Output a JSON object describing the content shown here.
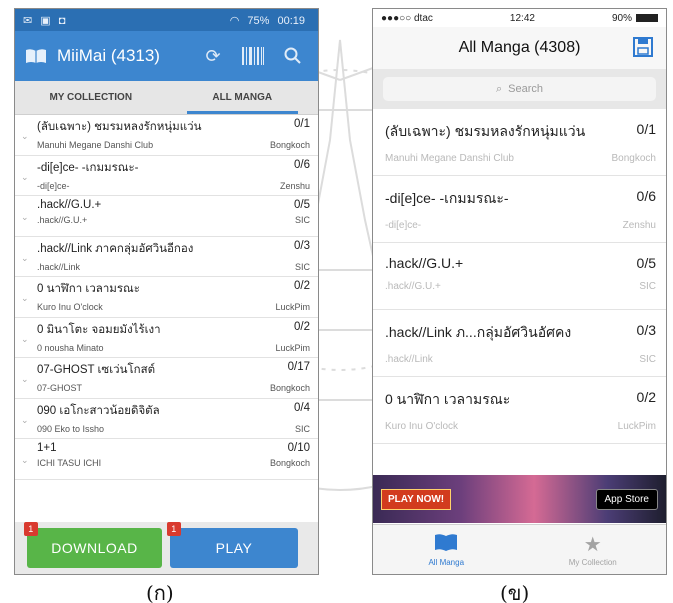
{
  "android": {
    "status": {
      "battery": "75%",
      "time": "00:19"
    },
    "appbar": {
      "title": "MiiMai (4313)",
      "icons": [
        "book-icon",
        "refresh-icon",
        "barcode-icon",
        "search-icon"
      ]
    },
    "tabs": [
      {
        "label": "MY COLLECTION",
        "active": false
      },
      {
        "label": "ALL MANGA",
        "active": true
      }
    ],
    "rows": [
      {
        "title": "(ลับเฉพาะ) ชมรมหลงรักหนุ่มแว่น",
        "count": "0/1",
        "subtitle": "Manuhi Megane Danshi Club",
        "publisher": "Bongkoch"
      },
      {
        "title": "-di[e]ce- -เกมมรณะ-",
        "count": "0/6",
        "subtitle": "-di[e]ce-",
        "publisher": "Zenshu"
      },
      {
        "title": ".hack//G.U.+",
        "count": "0/5",
        "subtitle": ".hack//G.U.+",
        "publisher": "SIC"
      },
      {
        "title": ".hack//Link ภาคกลุ่มอัศวินอีกอง",
        "count": "0/3",
        "subtitle": ".hack//Link",
        "publisher": "SIC"
      },
      {
        "title": "0 นาฬิกา เวลามรณะ",
        "count": "0/2",
        "subtitle": "Kuro Inu O'clock",
        "publisher": "LuckPim"
      },
      {
        "title": "0 มินาโตะ จอมยมังไร้เงา",
        "count": "0/2",
        "subtitle": "0 nousha Minato",
        "publisher": "LuckPim"
      },
      {
        "title": "07-GHOST เซเว่นโกสต์",
        "count": "0/17",
        "subtitle": "07-GHOST",
        "publisher": "Bongkoch"
      },
      {
        "title": "090 เอโกะสาวน้อยดิจิตัล",
        "count": "0/4",
        "subtitle": "090 Eko to Issho",
        "publisher": "SIC"
      },
      {
        "title": "1+1",
        "count": "0/10",
        "subtitle": "ICHI TASU ICHI",
        "publisher": "Bongkoch"
      }
    ],
    "bottom": {
      "download_label": "DOWNLOAD",
      "play_label": "PLAY",
      "badge": "1"
    }
  },
  "ios": {
    "status": {
      "carrier": "●●●○○ dtac",
      "time": "12:42",
      "battery": "90%"
    },
    "nav": {
      "title": "All Manga (4308)",
      "icon": "save-icon"
    },
    "search": {
      "placeholder": "Search"
    },
    "rows": [
      {
        "title": "(ลับเฉพาะ) ชมรมหลงรักหนุ่มแว่น",
        "count": "0/1",
        "subtitle": "Manuhi Megane Danshi Club",
        "publisher": "Bongkoch"
      },
      {
        "title": "-di[e]ce- -เกมมรณะ-",
        "count": "0/6",
        "subtitle": "-di[e]ce-",
        "publisher": "Zenshu"
      },
      {
        "title": ".hack//G.U.+",
        "count": "0/5",
        "subtitle": ".hack//G.U.+",
        "publisher": "SIC"
      },
      {
        "title": ".hack//Link ภ...กลุ่มอัศวินอัศคง",
        "count": "0/3",
        "subtitle": ".hack//Link",
        "publisher": "SIC"
      },
      {
        "title": "0 นาฬิกา เวลามรณะ",
        "count": "0/2",
        "subtitle": "Kuro Inu O'clock",
        "publisher": "LuckPim"
      }
    ],
    "ad": {
      "play": "PLAY NOW!",
      "store": "App Store"
    },
    "tabbar": [
      {
        "label": "All Manga",
        "icon": "book-icon",
        "active": true
      },
      {
        "label": "My Collection",
        "icon": "star-icon",
        "active": false
      }
    ]
  },
  "captions": {
    "a": "(ก)",
    "b": "(ข)"
  }
}
